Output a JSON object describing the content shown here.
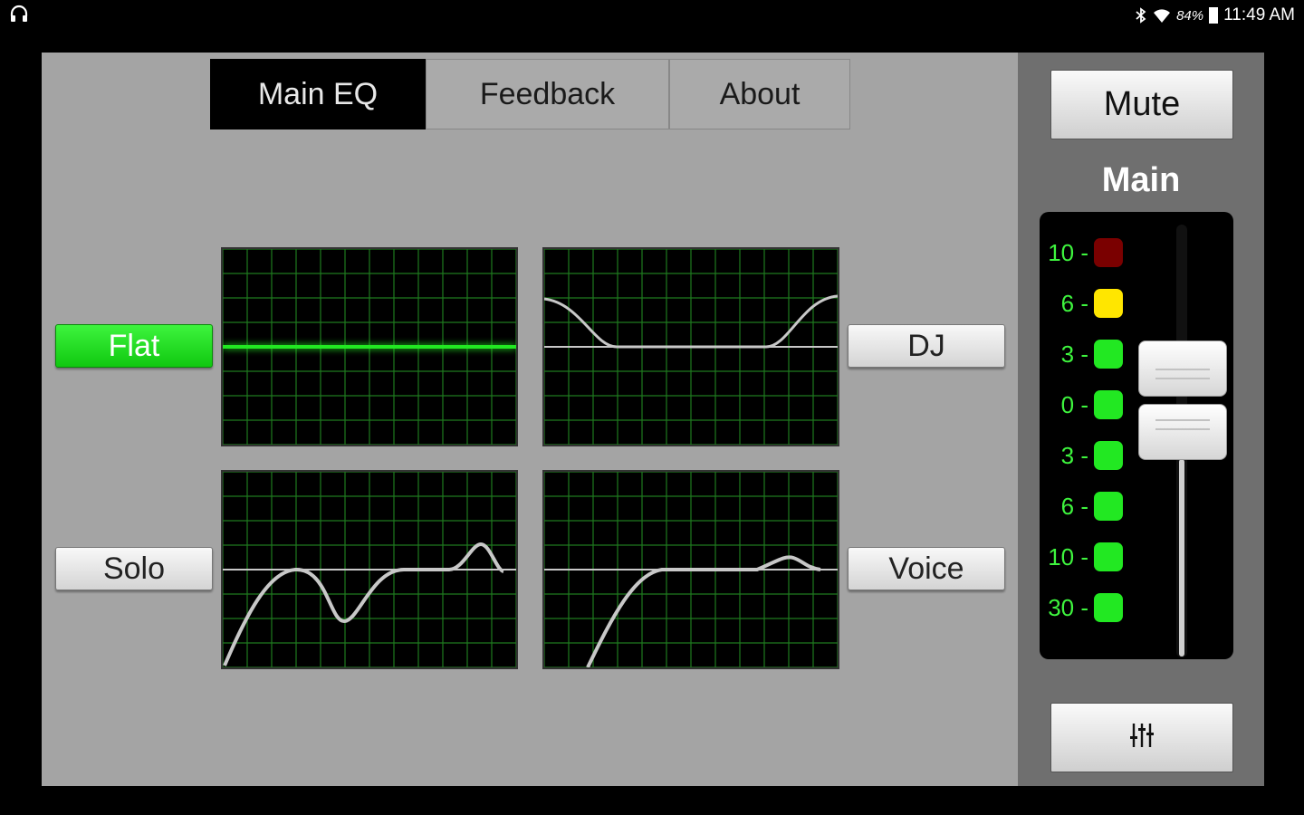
{
  "status_bar": {
    "battery_percent": "84%",
    "time": "11:49 AM",
    "icons": [
      "headphones-icon",
      "bluetooth-icon",
      "wifi-icon",
      "battery-icon"
    ]
  },
  "tabs": [
    {
      "label": "Main EQ",
      "active": true
    },
    {
      "label": "Feedback",
      "active": false
    },
    {
      "label": "About",
      "active": false
    }
  ],
  "presets": {
    "flat": {
      "label": "Flat",
      "active": true
    },
    "dj": {
      "label": "DJ",
      "active": false
    },
    "solo": {
      "label": "Solo",
      "active": false
    },
    "voice": {
      "label": "Voice",
      "active": false
    }
  },
  "right_panel": {
    "mute_label": "Mute",
    "channel_label": "Main",
    "meter_labels": [
      "10 -",
      "6 -",
      "3 -",
      "0 -",
      "3 -",
      "6 -",
      "10 -",
      "30 -"
    ],
    "meter_colors": [
      "#7a0000",
      "#ffe600",
      "#22e822",
      "#22e822",
      "#22e822",
      "#22e822",
      "#22e822",
      "#22e822"
    ],
    "fader_level": 0.56,
    "settings_icon": "equalizer-sliders-icon"
  },
  "colors": {
    "accent_green": "#22e822",
    "panel_gray": "#a4a4a4",
    "grid_green": "#1f7a1f"
  }
}
